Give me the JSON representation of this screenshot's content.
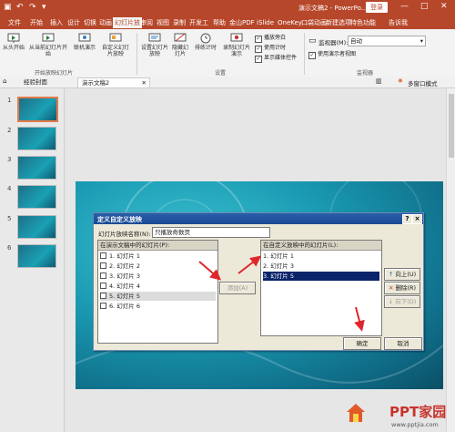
{
  "titlebar": {
    "doc_title": "演示文稿2 - PowerPo...",
    "login_label": "登录",
    "window_buttons": [
      "—",
      "□",
      "✕"
    ],
    "colors": {
      "bar": "#b7472a"
    }
  },
  "tabs": [
    {
      "label": "文件",
      "active": false
    },
    {
      "label": "开始",
      "active": false
    },
    {
      "label": "插入",
      "active": false
    },
    {
      "label": "设计",
      "active": false
    },
    {
      "label": "切换",
      "active": false
    },
    {
      "label": "动画",
      "active": false
    },
    {
      "label": "幻灯片放",
      "active": true
    },
    {
      "label": "审阅",
      "active": false
    },
    {
      "label": "视图",
      "active": false
    },
    {
      "label": "录制",
      "active": false
    },
    {
      "label": "开发工",
      "active": false
    },
    {
      "label": "帮助",
      "active": false
    },
    {
      "label": "金山PDF",
      "active": false
    },
    {
      "label": "iSlide",
      "active": false
    },
    {
      "label": "OneKey",
      "active": false
    },
    {
      "label": "口袋动画",
      "active": false
    },
    {
      "label": "新建选项",
      "active": false
    },
    {
      "label": "特色功能",
      "active": false
    },
    {
      "label": "告诉我",
      "active": false
    }
  ],
  "ribbon": {
    "from_start": "从头开始",
    "from_current": "从当前幻灯片开始",
    "online_present": "联机演示",
    "custom_show": "自定义幻灯片放映",
    "group_start": "开始放映幻灯片",
    "setup_show": "设置幻灯片放映",
    "hide_slide": "隐藏幻灯片",
    "rehearse": "排练计时",
    "record": "录制幻灯片演示",
    "play_narration": "播放旁白",
    "use_timings": "使用计时",
    "show_media": "显示媒体控件",
    "group_setup": "设置",
    "monitor_label": "监视器(M):",
    "monitor_value": "自动",
    "presenter_view": "使用演示者视图",
    "group_monitors": "监视器"
  },
  "doc_tabs": [
    {
      "label": "经验封面",
      "active": false
    },
    {
      "label": "演示文稿2",
      "active": true
    }
  ],
  "doc_bar_right": "多窗口模式",
  "thumbnails": [
    "1",
    "2",
    "3",
    "4",
    "5",
    "6"
  ],
  "dialog": {
    "title": "定义自定义放映",
    "name_label": "幻灯片放映名称(N):",
    "name_value": "只播放奇数页",
    "left_header": "在演示文稿中的幻灯片(P):",
    "left_items": [
      "1. 幻灯片 1",
      "2. 幻灯片 2",
      "3. 幻灯片 3",
      "4. 幻灯片 4",
      "5. 幻灯片 5",
      "6. 幻灯片 6"
    ],
    "add_button": "添加(A)",
    "right_header": "在自定义放映中的幻灯片(L):",
    "right_items": [
      "1. 幻灯片 1",
      "2. 幻灯片 3",
      "3. 幻灯片 5"
    ],
    "up_button": "向上(U)",
    "delete_button": "删除(R)",
    "down_button": "向下(D)",
    "ok_button": "确定",
    "cancel_button": "取消"
  },
  "watermark": {
    "name": "PPT家园",
    "url": "www.pptjia.com"
  }
}
